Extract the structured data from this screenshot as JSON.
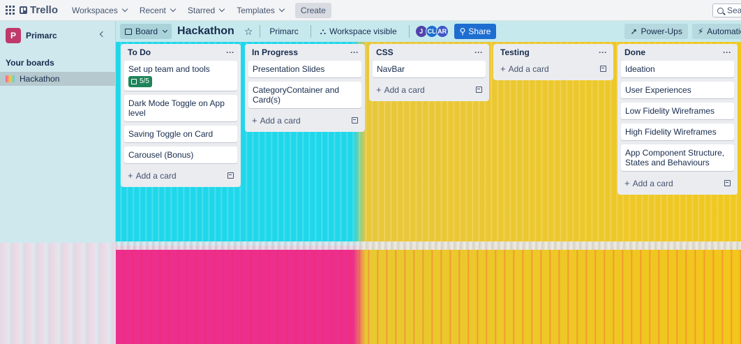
{
  "topnav": {
    "logo": "Trello",
    "menus": [
      "Workspaces",
      "Recent",
      "Starred",
      "Templates"
    ],
    "create": "Create",
    "search_placeholder": "Search"
  },
  "sidebar": {
    "workspace_initial": "P",
    "workspace_name": "Primarc",
    "section_title": "Your boards",
    "boards": [
      "Hackathon"
    ]
  },
  "board": {
    "view": "Board",
    "title": "Hackathon",
    "workspace": "Primarc",
    "visibility": "Workspace visible",
    "members": [
      {
        "initials": "J",
        "color": "#5243aa"
      },
      {
        "initials": "CL",
        "color": "#1e6ed1"
      },
      {
        "initials": "AR",
        "color": "#3d57c7"
      }
    ],
    "share": "Share",
    "powerups": "Power-Ups",
    "automation": "Automation"
  },
  "add_card_label": "Add a card",
  "lists": [
    {
      "title": "To Do",
      "cards": [
        {
          "text": "Set up team and tools",
          "badge": "5/5"
        },
        {
          "text": "Dark Mode Toggle on App level"
        },
        {
          "text": "Saving Toggle on Card"
        },
        {
          "text": "Carousel (Bonus)"
        }
      ]
    },
    {
      "title": "In Progress",
      "cards": [
        {
          "text": "Presentation Slides"
        },
        {
          "text": "CategoryContainer and Card(s)"
        }
      ]
    },
    {
      "title": "CSS",
      "cards": [
        {
          "text": "NavBar"
        }
      ]
    },
    {
      "title": "Testing",
      "cards": []
    },
    {
      "title": "Done",
      "cards": [
        {
          "text": "Ideation"
        },
        {
          "text": "User Experiences"
        },
        {
          "text": "Low Fidelity Wireframes"
        },
        {
          "text": "High Fidelity Wireframes"
        },
        {
          "text": "App Component Structure, States and Behaviours"
        }
      ]
    }
  ]
}
